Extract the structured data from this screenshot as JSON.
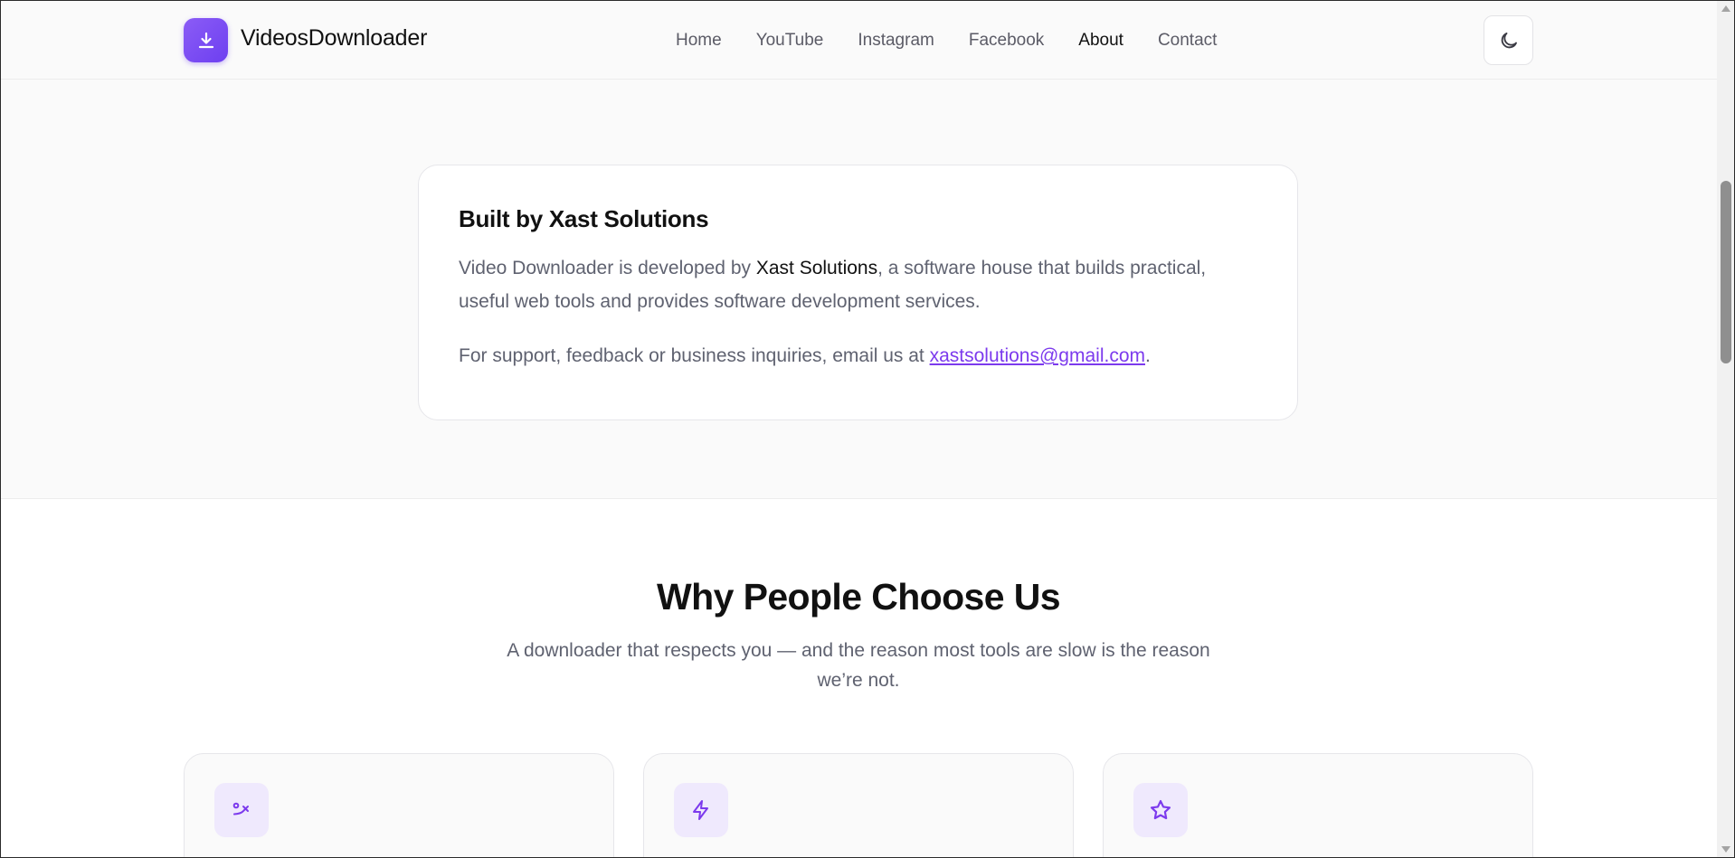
{
  "header": {
    "logo_text": "VideosDownloader",
    "nav": [
      {
        "label": "Home",
        "active": false
      },
      {
        "label": "YouTube",
        "active": false
      },
      {
        "label": "Instagram",
        "active": false
      },
      {
        "label": "Facebook",
        "active": false
      },
      {
        "label": "About",
        "active": true
      },
      {
        "label": "Contact",
        "active": false
      }
    ],
    "theme_toggle_icon": "moon-icon"
  },
  "about_card": {
    "title": "Built by Xast Solutions",
    "para1_prefix": "Video Downloader is developed by ",
    "para1_company": "Xast Solutions",
    "para1_suffix": ", a software house that builds practical, useful web tools and provides software development services.",
    "para2_prefix": "For support, feedback or business inquiries, email us at ",
    "email": "xastsolutions@gmail.com",
    "para2_suffix": "."
  },
  "why": {
    "title": "Why People Choose Us",
    "subtitle": "A downloader that respects you — and the reason most tools are slow is the reason we’re not.",
    "cards": [
      {
        "icon": "route-icon"
      },
      {
        "icon": "lightning-icon"
      },
      {
        "icon": "star-icon"
      }
    ]
  },
  "colors": {
    "accent": "#7c3aed",
    "logo_gradient_start": "#8b5cf6",
    "logo_gradient_end": "#6d3ff0",
    "icon_bg": "#efe9fd"
  }
}
